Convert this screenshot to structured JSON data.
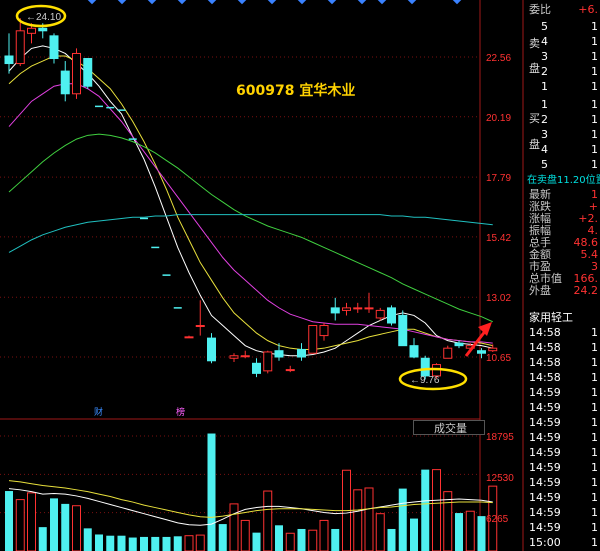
{
  "stock": {
    "code": "600978",
    "name": "宜华木业",
    "color": "#ffd200"
  },
  "axis": {
    "price_ticks": [
      "22.56",
      "20.19",
      "17.79",
      "15.42",
      "13.02",
      "10.65"
    ],
    "volume_ticks": [
      "18795",
      "12530",
      "6265"
    ]
  },
  "annotations": {
    "high_label": "24.10",
    "low_label": "9.76",
    "marker_cai": "财",
    "marker_bang": "榜"
  },
  "volume_selector": {
    "label": "成交量"
  },
  "order_book": {
    "weibi_label": "委比",
    "weibi_value": "+6.",
    "sell_side_label": [
      "卖",
      "盘"
    ],
    "sell_levels": [
      "5",
      "4",
      "3",
      "2",
      "1"
    ],
    "sell_values": [
      "1",
      "1",
      "1",
      "1",
      "1"
    ],
    "buy_side_label": [
      "买",
      "盘"
    ],
    "buy_levels": [
      "1",
      "2",
      "3",
      "4",
      "5"
    ],
    "buy_values": [
      "1",
      "1",
      "1",
      "1",
      "1"
    ],
    "sell_queue_label": "在卖盘11.20位置"
  },
  "quote": [
    {
      "label": "最新",
      "value": "1"
    },
    {
      "label": "涨跌",
      "value": "+"
    },
    {
      "label": "涨幅",
      "value": "+2."
    },
    {
      "label": "振幅",
      "value": "4."
    },
    {
      "label": "总手",
      "value": "48.6"
    },
    {
      "label": "金额",
      "value": "5.4"
    },
    {
      "label": "市盈",
      "value": "3"
    },
    {
      "label": "总市值",
      "value": "166."
    },
    {
      "label": "外盘",
      "value": "24.2"
    }
  ],
  "industry": "家用轻工",
  "ticks_times": [
    "14:58",
    "14:58",
    "14:58",
    "14:58",
    "14:59",
    "14:59",
    "14:59",
    "14:59",
    "14:59",
    "14:59",
    "14:59",
    "14:59",
    "14:59",
    "14:59",
    "15:00"
  ],
  "ticks_values": [
    "1",
    "1",
    "1",
    "1",
    "1",
    "1",
    "1",
    "1",
    "1",
    "1",
    "1",
    "1",
    "1",
    "1",
    "1"
  ],
  "chart_data": [
    {
      "type": "candlestick",
      "title": "600978 宜华木业",
      "y_ticks": [
        22.56,
        20.19,
        17.79,
        15.42,
        13.02,
        10.65
      ],
      "ylim": [
        8.6,
        24.35
      ],
      "ohlc": [
        [
          22.6,
          23.5,
          21.9,
          22.3
        ],
        [
          22.3,
          24.1,
          22.2,
          23.6
        ],
        [
          23.5,
          23.9,
          23.1,
          23.7
        ],
        [
          23.7,
          23.9,
          23.3,
          23.6
        ],
        [
          23.4,
          23.5,
          22.3,
          22.5
        ],
        [
          22.0,
          22.4,
          20.8,
          21.1
        ],
        [
          21.1,
          22.9,
          20.9,
          22.7
        ],
        [
          22.5,
          22.5,
          21.3,
          21.4
        ],
        [
          null,
          null,
          null,
          20.6
        ],
        [
          null,
          null,
          null,
          20.55
        ],
        [
          null,
          null,
          null,
          20.45
        ],
        [
          null,
          null,
          null,
          19.3
        ],
        [
          null,
          null,
          null,
          16.15
        ],
        [
          null,
          null,
          null,
          15.0
        ],
        [
          null,
          null,
          null,
          13.9
        ],
        [
          null,
          null,
          null,
          12.6
        ],
        [
          11.45,
          11.5,
          11.45,
          11.45
        ],
        [
          11.9,
          12.9,
          11.5,
          11.9
        ],
        [
          11.4,
          11.6,
          10.4,
          10.5
        ],
        [
          null,
          null,
          null,
          null
        ],
        [
          10.6,
          10.8,
          10.45,
          10.7
        ],
        [
          10.7,
          10.9,
          10.6,
          10.7
        ],
        [
          10.4,
          10.6,
          9.85,
          10.0
        ],
        [
          10.1,
          10.9,
          10.0,
          10.85
        ],
        [
          10.9,
          11.2,
          10.5,
          10.65
        ],
        [
          10.15,
          10.3,
          10.05,
          10.15
        ],
        [
          10.95,
          11.2,
          10.5,
          10.65
        ],
        [
          10.8,
          11.9,
          10.8,
          11.9
        ],
        [
          11.5,
          12.0,
          11.3,
          11.9
        ],
        [
          12.6,
          13.0,
          12.1,
          12.4
        ],
        [
          12.5,
          12.8,
          12.3,
          12.6
        ],
        [
          12.6,
          12.8,
          12.4,
          12.6
        ],
        [
          12.6,
          13.2,
          12.4,
          12.6
        ],
        [
          12.2,
          12.6,
          12.1,
          12.5
        ],
        [
          12.6,
          12.7,
          11.9,
          12.0
        ],
        [
          12.3,
          12.5,
          11.1,
          11.1
        ],
        [
          11.1,
          11.4,
          10.6,
          10.65
        ],
        [
          10.6,
          10.7,
          9.76,
          9.9
        ],
        [
          9.9,
          10.4,
          9.8,
          10.35
        ],
        [
          10.6,
          11.1,
          10.6,
          11.0
        ],
        [
          11.2,
          11.3,
          11.0,
          11.1
        ],
        [
          11.0,
          11.2,
          10.9,
          11.1
        ],
        [
          10.9,
          11.0,
          10.6,
          10.8
        ],
        [
          10.9,
          11.15,
          10.85,
          11.0
        ]
      ],
      "ma_series": [
        {
          "color": "#ffffff",
          "values": [
            22.0,
            22.5,
            22.9,
            23.0,
            22.9,
            22.7,
            22.3,
            21.9,
            21.4,
            20.8,
            20.3,
            19.4,
            18.5,
            17.4,
            16.2,
            15.0,
            14.0,
            13.1,
            12.3,
            11.9,
            11.5,
            11.1,
            10.9,
            10.8,
            10.75,
            10.7,
            10.7,
            10.75,
            10.85,
            11.0,
            11.3,
            11.6,
            11.9,
            12.1,
            12.3,
            12.4,
            12.3,
            12.0,
            11.5,
            11.3,
            11.2,
            11.15,
            11.1,
            11.0
          ]
        },
        {
          "color": "#e8e03c",
          "values": [
            21.5,
            21.9,
            22.2,
            22.4,
            22.6,
            22.6,
            22.4,
            22.1,
            21.7,
            21.3,
            20.7,
            20.0,
            19.2,
            18.3,
            17.3,
            16.2,
            15.3,
            14.4,
            13.7,
            13.0,
            12.4,
            12.0,
            11.6,
            11.3,
            11.1,
            11.0,
            10.95,
            10.95,
            11.0,
            11.1,
            11.2,
            11.3,
            11.45,
            11.55,
            11.65,
            11.75,
            11.75,
            11.6,
            11.45,
            11.35,
            11.3,
            11.25,
            11.2,
            11.1
          ]
        },
        {
          "color": "#e040e0",
          "values": [
            19.8,
            20.3,
            20.8,
            21.1,
            21.4,
            21.5,
            21.5,
            21.3,
            21.0,
            20.5,
            20.0,
            19.4,
            18.8,
            18.2,
            17.6,
            17.0,
            16.4,
            15.8,
            15.2,
            14.6,
            14.1,
            13.7,
            13.3,
            12.9,
            12.6,
            12.35,
            12.2,
            12.05,
            12.0,
            11.95,
            11.95,
            11.95,
            11.9,
            11.85,
            11.8,
            11.75,
            11.65,
            11.55,
            11.45,
            11.35,
            11.3,
            11.25,
            11.25,
            11.2
          ]
        },
        {
          "color": "#40d040",
          "values": [
            17.2,
            17.6,
            18.0,
            18.4,
            18.75,
            19.05,
            19.3,
            19.45,
            19.5,
            19.45,
            19.35,
            19.2,
            19.0,
            18.75,
            18.45,
            18.15,
            17.8,
            17.45,
            17.1,
            16.8,
            16.5,
            16.25,
            16.05,
            15.85,
            15.7,
            15.55,
            15.4,
            15.2,
            15.0,
            14.8,
            14.6,
            14.4,
            14.2,
            14.0,
            13.8,
            13.55,
            13.35,
            13.15,
            12.95,
            12.75,
            12.55,
            12.4,
            12.25,
            12.05
          ]
        },
        {
          "color": "#20c0c0",
          "values": [
            14.8,
            15.05,
            15.3,
            15.5,
            15.65,
            15.8,
            15.9,
            16.0,
            16.05,
            16.1,
            16.15,
            16.2,
            16.2,
            16.25,
            16.25,
            16.3,
            16.3,
            16.3,
            16.3,
            16.3,
            16.3,
            16.3,
            16.3,
            16.3,
            16.3,
            16.3,
            16.3,
            16.3,
            16.3,
            16.3,
            16.3,
            16.3,
            16.3,
            16.3,
            16.25,
            16.25,
            16.2,
            16.2,
            16.15,
            16.1,
            16.05,
            16.0,
            15.95,
            15.9
          ]
        }
      ]
    },
    {
      "type": "bar",
      "title": "成交量",
      "y_ticks": [
        18795,
        12530,
        6265
      ],
      "ylim": [
        0,
        21500
      ],
      "values": [
        9800,
        8400,
        9500,
        3900,
        8600,
        7700,
        7400,
        3700,
        2700,
        2500,
        2500,
        2200,
        2300,
        2300,
        2300,
        2400,
        2500,
        2600,
        19200,
        4400,
        7700,
        5000,
        3000,
        9800,
        4200,
        2900,
        3600,
        3400,
        5000,
        3600,
        13200,
        10000,
        10300,
        6100,
        3600,
        10200,
        5300,
        13300,
        13300,
        9700,
        6200,
        6500,
        5700,
        10600
      ],
      "up_color": "#ff3232",
      "down_color": "#4ff0f0",
      "ma_series": [
        {
          "color": "#ffffff",
          "values": [
            10200,
            10000,
            9700,
            9300,
            9400,
            9300,
            9000,
            8600,
            8100,
            7600,
            7100,
            6600,
            6100,
            5600,
            5100,
            4600,
            4300,
            4200,
            4400,
            5200,
            6100,
            6800,
            7100,
            7300,
            7300,
            7100,
            6900,
            6600,
            6300,
            6100,
            6200,
            6500,
            6900,
            7200,
            7500,
            7800,
            8000,
            8200,
            8300,
            8400,
            8500,
            8400,
            8300,
            8000
          ]
        },
        {
          "color": "#e8e03c",
          "values": [
            11500,
            11300,
            11000,
            10700,
            10500,
            10300,
            10000,
            9700,
            9300,
            8900,
            8400,
            8000,
            7500,
            7100,
            6700,
            6300,
            5900,
            5600,
            5500,
            5700,
            6000,
            6300,
            6600,
            6800,
            6900,
            6900,
            6900,
            6800,
            6700,
            6600,
            6600,
            6700,
            6900,
            7100,
            7200,
            7400,
            7600,
            7700,
            7800,
            7900,
            8000,
            8000,
            8000,
            7900
          ]
        }
      ]
    }
  ]
}
